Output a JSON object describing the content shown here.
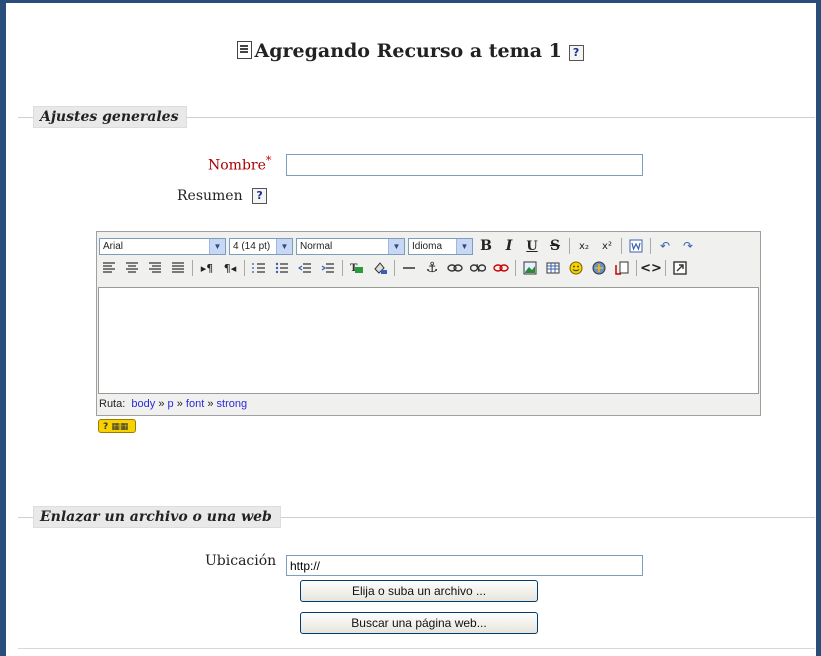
{
  "page": {
    "title": "Agregando Recurso a tema 1",
    "help_glyph": "?"
  },
  "general": {
    "legend": "Ajustes generales",
    "name_label": "Nombre",
    "required_mark": "*",
    "name_value": "",
    "summary_label": "Resumen",
    "help_glyph": "?"
  },
  "editor": {
    "font_family": "Arial",
    "font_size": "4 (14 pt)",
    "format": "Normal",
    "language": "Idioma",
    "bold": "B",
    "italic": "I",
    "underline": "U",
    "strike": "S",
    "subscript": "x₂",
    "superscript": "x²",
    "path_label": "Ruta:",
    "path_body": "body",
    "path_p": "p",
    "path_font": "font",
    "path_strong": "strong",
    "path_sep": "»",
    "keyboard_help": "?"
  },
  "link": {
    "legend": "Enlazar un archivo o una web",
    "location_label": "Ubicación",
    "location_value": "http://",
    "choose_file_button": "Elija o suba un archivo ...",
    "search_web_button": "Buscar una página web..."
  },
  "colors": {
    "frame": "#2a4e7c",
    "legend_bg": "#e9e9e9",
    "required": "#aa0000",
    "path_link": "#2b2bd6"
  }
}
